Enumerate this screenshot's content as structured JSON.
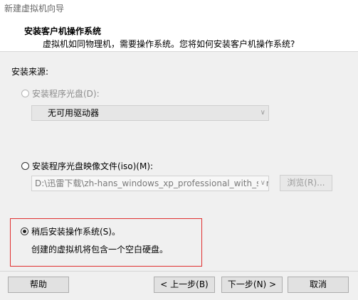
{
  "window": {
    "title": "新建虚拟机向导"
  },
  "header": {
    "title": "安装客户机操作系统",
    "subtitle": "虚拟机如同物理机，需要操作系统。您将如何安装客户机操作系统?"
  },
  "source": {
    "label": "安装来源:",
    "optical": {
      "label": "安装程序光盘(D):",
      "selected": false,
      "enabled": false,
      "drive_value": "无可用驱动器"
    },
    "iso": {
      "label": "安装程序光盘映像文件(iso)(M):",
      "selected": false,
      "path_value": "D:\\迅雷下载\\zh-hans_windows_xp_professional_with_ser",
      "browse_label": "浏览(R)..."
    },
    "later": {
      "label": "稍后安装操作系统(S)。",
      "selected": true,
      "description": "创建的虚拟机将包含一个空白硬盘。"
    }
  },
  "buttons": {
    "help": "帮助",
    "back": "< 上一步(B)",
    "next": "下一步(N) >",
    "cancel": "取消"
  },
  "icons": {
    "dropdown": "chevron-down-icon"
  },
  "colors": {
    "highlight_border": "#e03030"
  }
}
